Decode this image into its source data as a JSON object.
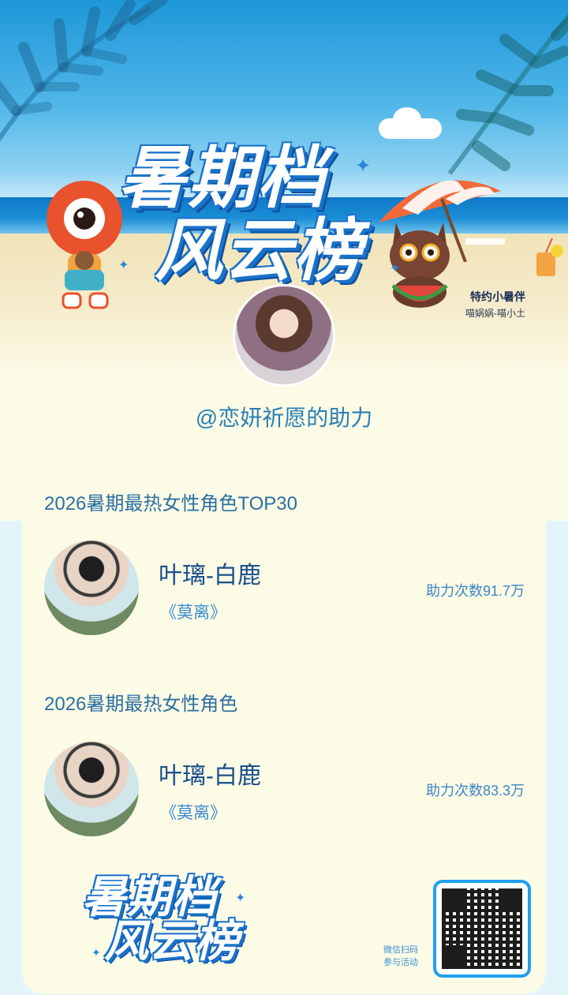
{
  "banner": {
    "title_line1": "暑期档",
    "title_line2": "风云榜",
    "sponsor_title": "特约小暑伴",
    "sponsor_sub": "喵娲娲-喵小土"
  },
  "helper": {
    "text": "@恋妍祈愿的助力"
  },
  "sections": [
    {
      "title": "2026暑期最热女性角色TOP30",
      "name": "叶璃-白鹿",
      "work": "《莫离》",
      "count": "助力次数91.7万"
    },
    {
      "title": "2026暑期最热女性角色",
      "name": "叶璃-白鹿",
      "work": "《莫离》",
      "count": "助力次数83.3万"
    }
  ],
  "footer": {
    "logo_line1": "暑期档",
    "logo_line2": "风云榜",
    "qr_label_line1": "微信扫码",
    "qr_label_line2": "参与活动"
  },
  "colors": {
    "accent": "#1f9ff0",
    "title_blue": "#2c6fa3",
    "name_blue": "#1a4f8a",
    "card_bg": "#fbfbe6"
  }
}
